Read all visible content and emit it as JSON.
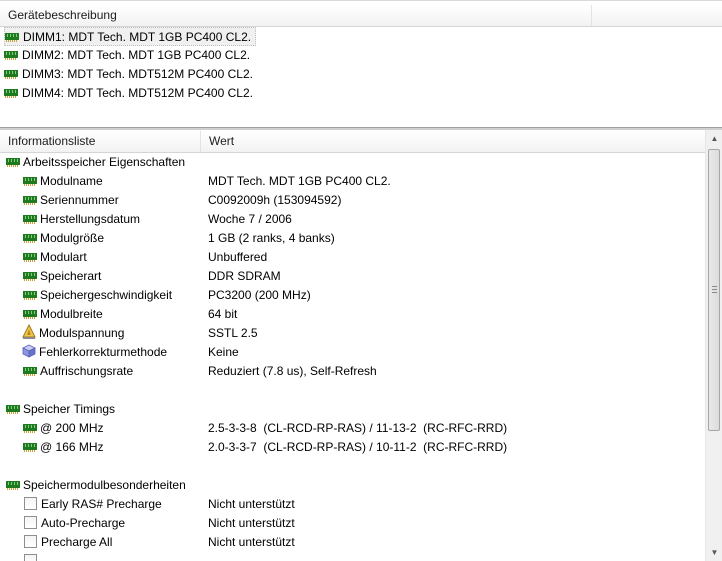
{
  "device_panel": {
    "header": "Gerätebeschreibung",
    "items": [
      {
        "label": "DIMM1: MDT Tech. MDT 1GB PC400 CL2.",
        "selected": true,
        "icon": "ram-module-icon"
      },
      {
        "label": "DIMM2: MDT Tech. MDT 1GB PC400 CL2.",
        "selected": false,
        "icon": "ram-module-icon"
      },
      {
        "label": "DIMM3: MDT Tech. MDT512M PC400 CL2.",
        "selected": false,
        "icon": "ram-module-icon"
      },
      {
        "label": "DIMM4: MDT Tech. MDT512M PC400 CL2.",
        "selected": false,
        "icon": "ram-module-icon"
      }
    ]
  },
  "info_panel": {
    "columns": [
      "Informationsliste",
      "Wert"
    ],
    "groups": [
      {
        "title": "Arbeitsspeicher Eigenschaften",
        "icon": "ram-module-icon",
        "rows": [
          {
            "key": "Modulname",
            "value": "MDT Tech. MDT 1GB PC400 CL2.",
            "icon": "ram-module-icon"
          },
          {
            "key": "Seriennummer",
            "value": "C0092009h (153094592)",
            "icon": "ram-module-icon"
          },
          {
            "key": "Herstellungsdatum",
            "value": "Woche 7 / 2006",
            "icon": "ram-module-icon"
          },
          {
            "key": "Modulgröße",
            "value": "1 GB (2 ranks, 4 banks)",
            "icon": "ram-module-icon"
          },
          {
            "key": "Modulart",
            "value": "Unbuffered",
            "icon": "ram-module-icon"
          },
          {
            "key": "Speicherart",
            "value": "DDR SDRAM",
            "icon": "ram-module-icon"
          },
          {
            "key": "Speichergeschwindigkeit",
            "value": "PC3200 (200 MHz)",
            "icon": "ram-module-icon"
          },
          {
            "key": "Modulbreite",
            "value": "64 bit",
            "icon": "ram-module-icon"
          },
          {
            "key": "Modulspannung",
            "value": "SSTL 2.5",
            "icon": "voltage-warning-icon"
          },
          {
            "key": "Fehlerkorrekturmethode",
            "value": "Keine",
            "icon": "cube-icon"
          },
          {
            "key": "Auffrischungsrate",
            "value": "Reduziert (7.8 us), Self-Refresh",
            "icon": "ram-module-icon"
          }
        ]
      },
      {
        "title": "Speicher Timings",
        "icon": "ram-module-icon",
        "rows": [
          {
            "key": "@ 200 MHz",
            "value": "2.5-3-3-8  (CL-RCD-RP-RAS) / 11-13-2  (RC-RFC-RRD)",
            "icon": "ram-module-icon"
          },
          {
            "key": "@ 166 MHz",
            "value": "2.0-3-3-7  (CL-RCD-RP-RAS) / 10-11-2  (RC-RFC-RRD)",
            "icon": "ram-module-icon"
          }
        ]
      },
      {
        "title": "Speichermodulbesonderheiten",
        "icon": "ram-module-icon",
        "rows": [
          {
            "key": "Early RAS# Precharge",
            "value": "Nicht unterstützt",
            "icon": "checkbox-icon"
          },
          {
            "key": "Auto-Precharge",
            "value": "Nicht unterstützt",
            "icon": "checkbox-icon"
          },
          {
            "key": "Precharge All",
            "value": "Nicht unterstützt",
            "icon": "checkbox-icon"
          }
        ]
      }
    ]
  },
  "colors": {
    "ram_green": "#1f7a1f",
    "selection": "#f0f0f0"
  }
}
